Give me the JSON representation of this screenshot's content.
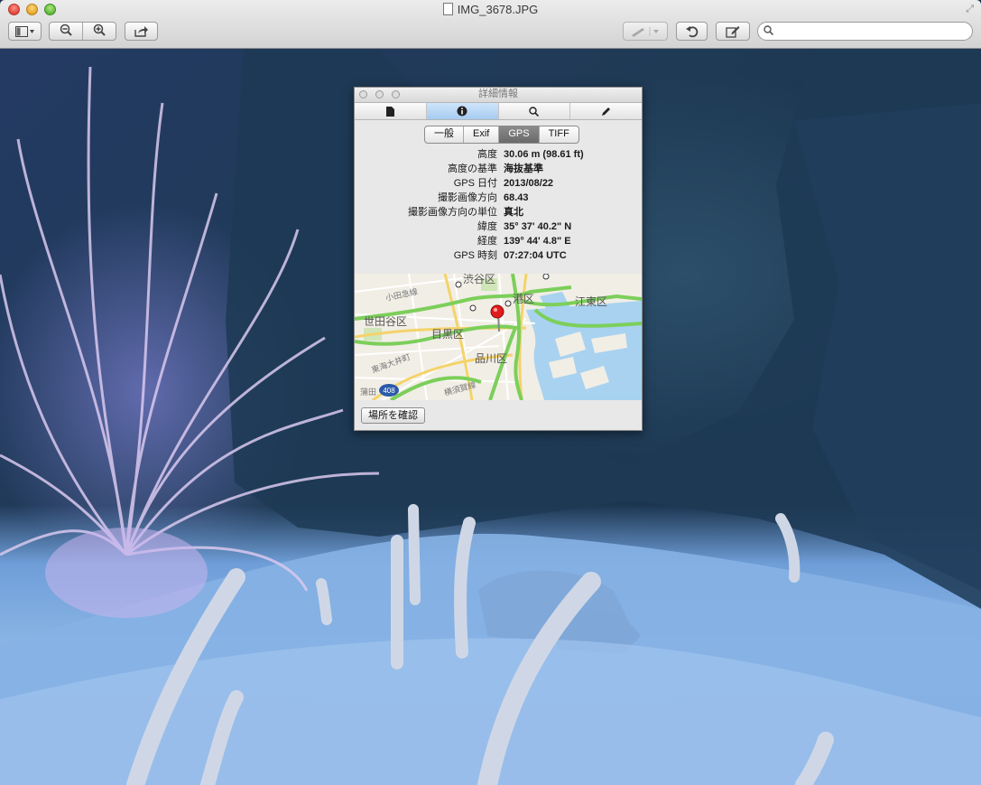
{
  "window": {
    "title": "IMG_3678.JPG",
    "colors": {
      "close": "#e0443b",
      "minimize": "#e2a526",
      "maximize": "#5db839"
    }
  },
  "toolbar": {
    "sidebar_icon": "sidebar-icon",
    "zoom_out_icon": "zoom-out-icon",
    "zoom_in_icon": "zoom-in-icon",
    "share_icon": "share-icon",
    "markup_icon": "pen-icon",
    "rotate_icon": "rotate-left-icon",
    "edit_icon": "edit-icon",
    "search": {
      "value": "",
      "placeholder": ""
    }
  },
  "inspector": {
    "title": "詳細情報",
    "tabs": [
      {
        "icon": "document-icon"
      },
      {
        "icon": "info-icon",
        "active": true
      },
      {
        "icon": "magnifier-icon"
      },
      {
        "icon": "pencil-icon"
      }
    ],
    "segments": [
      "一般",
      "Exif",
      "GPS",
      "TIFF"
    ],
    "selected_segment": "GPS",
    "rows": [
      {
        "label": "高度",
        "value": "30.06 m (98.61 ft)"
      },
      {
        "label": "高度の基準",
        "value": "海抜基準"
      },
      {
        "label": "GPS 日付",
        "value": "2013/08/22"
      },
      {
        "label": "撮影画像方向",
        "value": "68.43"
      },
      {
        "label": "撮影画像方向の単位",
        "value": "真北"
      },
      {
        "label": "緯度",
        "value": "35° 37' 40.2\" N"
      },
      {
        "label": "経度",
        "value": "139° 44' 4.8\" E"
      },
      {
        "label": "GPS 時刻",
        "value": "07:27:04 UTC"
      }
    ],
    "map": {
      "labels": {
        "shibuya": "渋谷区",
        "minato": "港区",
        "koto": "江東区",
        "setagaya": "世田谷区",
        "meguro": "目黒区",
        "shinagawa": "品川区",
        "odakyu": "小田急線",
        "tokaido": "東海大井町",
        "yokosuka": "横須賀線",
        "route": "408",
        "ota": "蒲田"
      },
      "colors": {
        "water": "#a8d2f0",
        "highway": "#7ccf5a",
        "road": "#f4d36a",
        "land": "#f1eee6",
        "pin": "#e01b1b"
      }
    },
    "show_location_button": "場所を確認"
  }
}
